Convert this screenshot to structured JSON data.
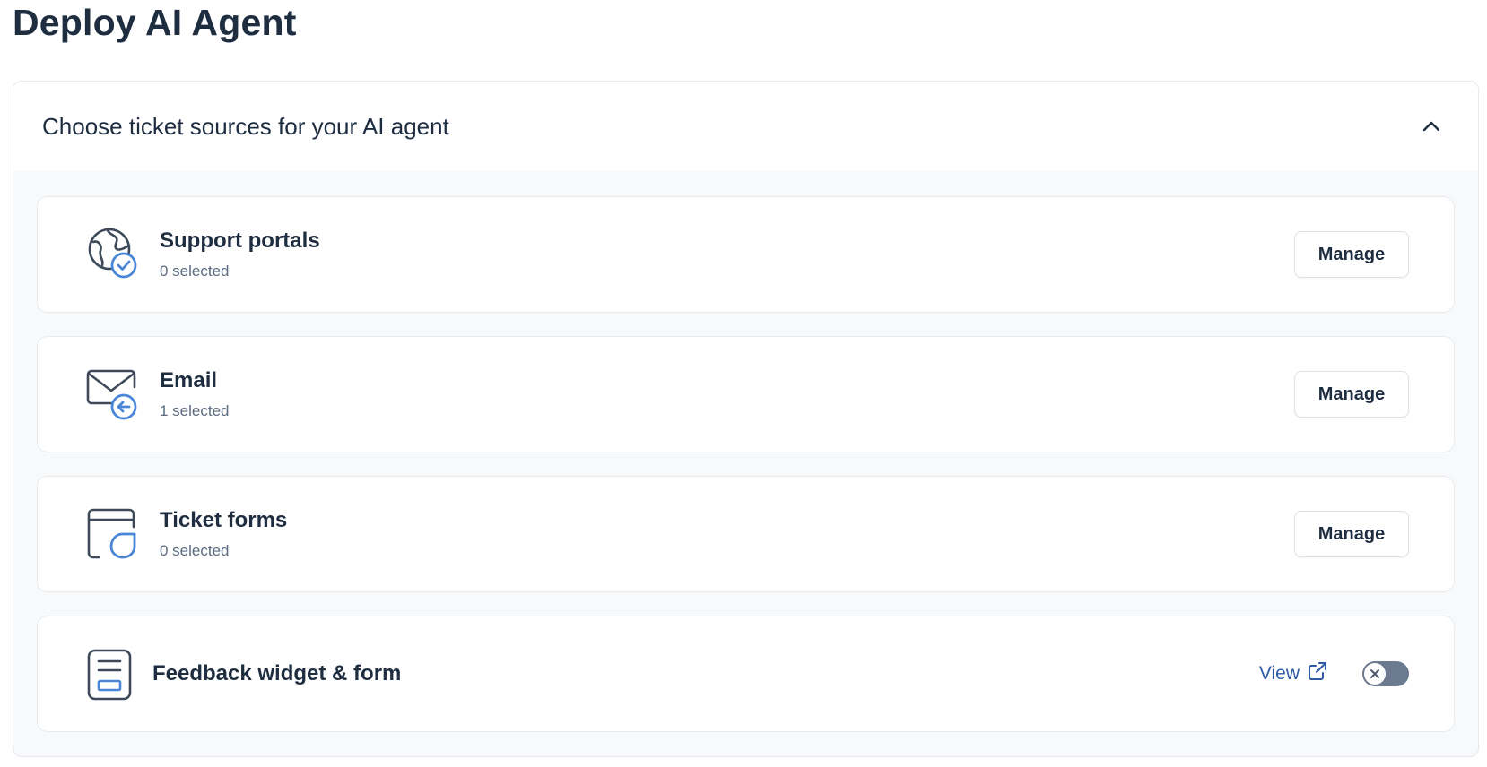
{
  "page": {
    "title": "Deploy AI Agent"
  },
  "panel": {
    "title": "Choose ticket sources for your AI agent",
    "collapse_icon": "chevron-up-icon"
  },
  "sources": [
    {
      "title": "Support portals",
      "subtitle": "0 selected",
      "action": "Manage",
      "icon": "globe-check-icon"
    },
    {
      "title": "Email",
      "subtitle": "1 selected",
      "action": "Manage",
      "icon": "mail-in-icon"
    },
    {
      "title": "Ticket forms",
      "subtitle": "0 selected",
      "action": "Manage",
      "icon": "form-window-icon"
    }
  ],
  "feedback": {
    "title": "Feedback widget & form",
    "view_label": "View",
    "view_icon": "external-link-icon",
    "toggle_on": false,
    "icon": "feedback-form-icon"
  },
  "colors": {
    "accent": "#4a86d8",
    "icon_stroke": "#3e4a5a",
    "link": "#2f5aa8",
    "toggle_off": "#6b7a8e"
  }
}
